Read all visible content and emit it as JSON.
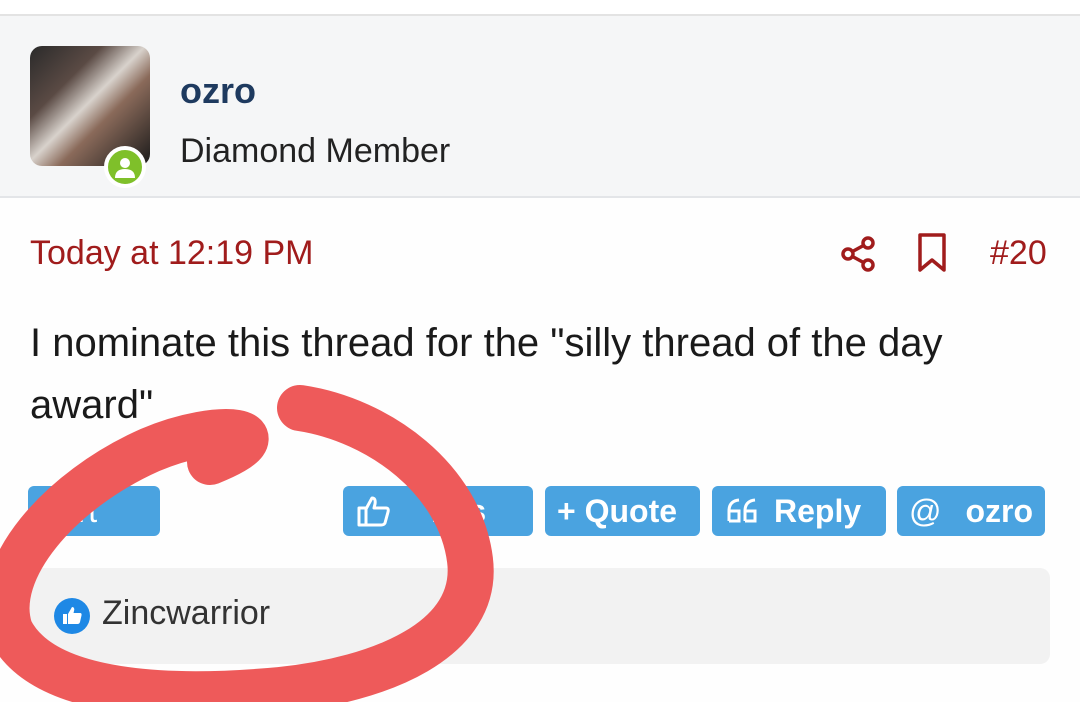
{
  "post": {
    "username": "ozro",
    "user_title": "Diamond Member",
    "date": "Today at 12:19 PM",
    "post_number": "#20",
    "text": "I nominate this thread for the \"silly thread of the day award\""
  },
  "actions": {
    "report_label": "port",
    "like_label": "nks",
    "quote_label": "+ Quote",
    "reply_label": "Reply",
    "mention_label": "ozro"
  },
  "reactions": {
    "users": "Zincwarrior"
  },
  "colors": {
    "accent_button": "#4aa3e0",
    "date_red": "#a01c1c",
    "username_navy": "#1e3a5f",
    "online_green": "#7fc02a",
    "annotation_red": "#ee5a5a"
  },
  "icons": [
    "avatar-status-icon",
    "share-icon",
    "bookmark-icon",
    "thumbs-up-icon",
    "quote-marks-icon",
    "at-icon",
    "like-reaction-icon"
  ]
}
